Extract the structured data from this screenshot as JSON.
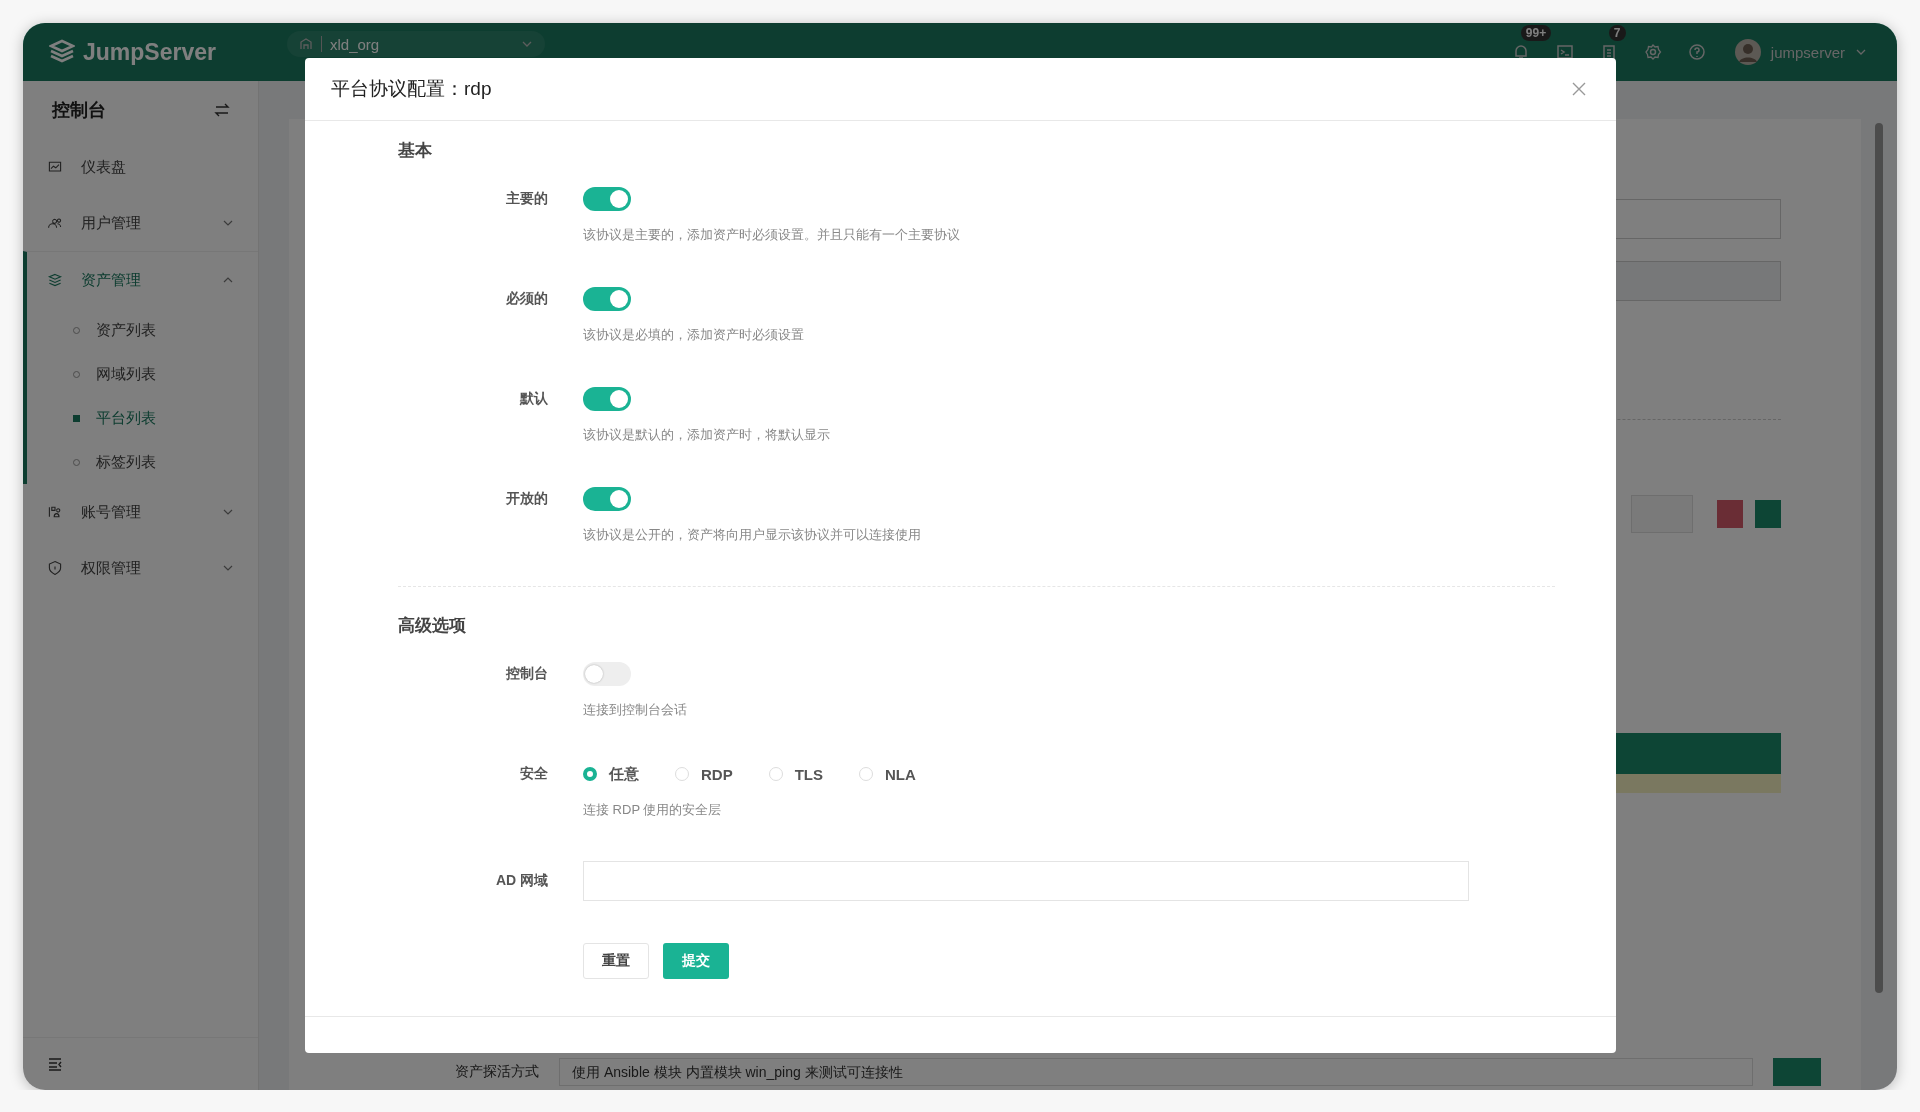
{
  "header": {
    "logo": "JumpServer",
    "org": "xld_org",
    "notice_badge": "99+",
    "task_badge": "7",
    "user": "jumpserver"
  },
  "sidebar": {
    "title": "控制台",
    "items": [
      {
        "label": "仪表盘",
        "kind": "link"
      },
      {
        "label": "用户管理",
        "kind": "group",
        "expanded": false
      },
      {
        "label": "资产管理",
        "kind": "group",
        "expanded": true,
        "children": [
          {
            "label": "资产列表",
            "selected": false
          },
          {
            "label": "网域列表",
            "selected": false
          },
          {
            "label": "平台列表",
            "selected": true
          },
          {
            "label": "标签列表",
            "selected": false
          }
        ]
      },
      {
        "label": "账号管理",
        "kind": "group",
        "expanded": false
      },
      {
        "label": "权限管理",
        "kind": "group",
        "expanded": false
      }
    ]
  },
  "background_form": {
    "probe_label": "资产探活方式",
    "probe_value": "使用 Ansible 模块 内置模块 win_ping 来测试可连接性"
  },
  "modal": {
    "title": "平台协议配置：rdp",
    "sections": [
      {
        "title": "基本",
        "fields": [
          {
            "kind": "switch",
            "label": "主要的",
            "on": true,
            "help": "该协议是主要的，添加资产时必须设置。并且只能有一个主要协议"
          },
          {
            "kind": "switch",
            "label": "必须的",
            "on": true,
            "help": "该协议是必填的，添加资产时必须设置"
          },
          {
            "kind": "switch",
            "label": "默认",
            "on": true,
            "help": "该协议是默认的，添加资产时，将默认显示"
          },
          {
            "kind": "switch",
            "label": "开放的",
            "on": true,
            "help": "该协议是公开的，资产将向用户显示该协议并可以连接使用"
          }
        ]
      },
      {
        "title": "高级选项",
        "fields": [
          {
            "kind": "switch",
            "label": "控制台",
            "on": false,
            "help": "连接到控制台会话"
          },
          {
            "kind": "radio",
            "label": "安全",
            "options": [
              {
                "label": "任意",
                "selected": true
              },
              {
                "label": "RDP",
                "selected": false
              },
              {
                "label": "TLS",
                "selected": false
              },
              {
                "label": "NLA",
                "selected": false
              }
            ],
            "help": "连接 RDP 使用的安全层"
          },
          {
            "kind": "input",
            "label": "AD 网域"
          }
        ]
      }
    ],
    "buttons": {
      "reset": "重置",
      "submit": "提交"
    }
  }
}
